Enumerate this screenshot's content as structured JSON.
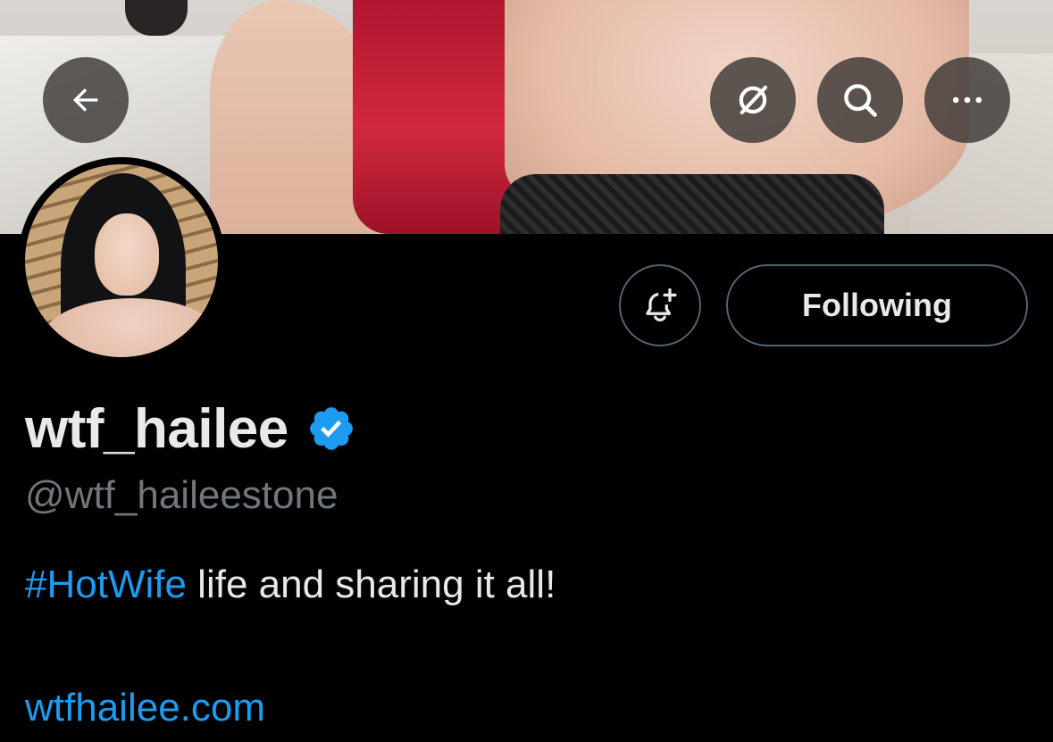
{
  "header": {
    "back_icon": "arrow-left-icon",
    "grok_icon": "grok-icon",
    "search_icon": "search-icon",
    "more_icon": "more-horizontal-icon"
  },
  "profile": {
    "display_name": "wtf_hailee",
    "verified": true,
    "verified_color": "#1d9bf0",
    "handle": "@wtf_haileestone",
    "bio_hashtag": "#HotWife",
    "bio_text": " life and sharing it all!",
    "website": "wtfhailee.com"
  },
  "actions": {
    "notify_icon": "bell-plus-icon",
    "following_label": "Following"
  },
  "colors": {
    "background": "#000000",
    "text_primary": "#e7e9ea",
    "text_secondary": "#71767b",
    "link": "#1d9bf0",
    "button_border": "#536471"
  }
}
